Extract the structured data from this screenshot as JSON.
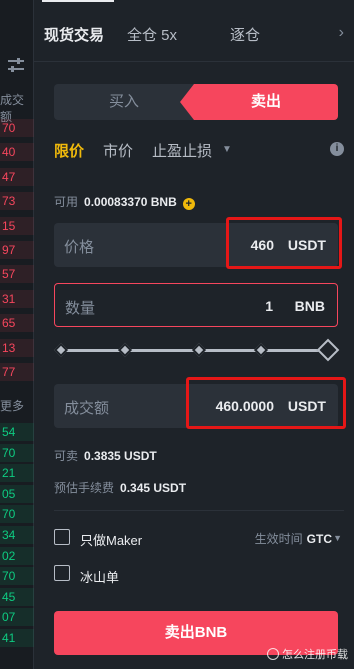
{
  "tabs": [
    {
      "label": "现货交易",
      "active": true
    },
    {
      "label": "全仓 5x",
      "active": false
    },
    {
      "label": "逐仓",
      "active": false
    }
  ],
  "tab_more_icon": "chevron-right-icon",
  "order_book": {
    "header_top": "成交额",
    "header_mid": "更多",
    "asks": [
      "70",
      "40",
      "47",
      "73",
      "15",
      "97",
      "57",
      "31",
      "65",
      "13",
      "77"
    ],
    "bids": [
      "54",
      "70",
      "21",
      "05",
      "70",
      "34",
      "02",
      "70",
      "45",
      "07",
      "41"
    ]
  },
  "side_toggle": {
    "buy": "买入",
    "sell": "卖出",
    "selected": "sell"
  },
  "order_types": {
    "limit": "限价",
    "market": "市价",
    "tpsl": "止盈止损",
    "selected": "limit"
  },
  "info_icon": "i",
  "available": {
    "label": "可用",
    "value": "0.00083370 BNB",
    "add_icon": "+"
  },
  "price_field": {
    "label": "价格",
    "value": "460",
    "unit": "USDT"
  },
  "qty_field": {
    "label": "数量",
    "value": "1",
    "unit": "BNB"
  },
  "slider": {
    "percent": 0
  },
  "total_field": {
    "label": "成交额",
    "value": "460.0000",
    "unit": "USDT"
  },
  "sellable": {
    "label": "可卖",
    "value": "0.3835 USDT"
  },
  "fee": {
    "label": "预估手续费",
    "value": "0.345 USDT"
  },
  "maker_only": {
    "label": "只做Maker",
    "checked": false
  },
  "iceberg": {
    "label": "冰山单",
    "checked": false
  },
  "time_in_force": {
    "label": "生效时间",
    "value": "GTC"
  },
  "submit_label": "卖出BNB",
  "watermark": "怎么注册币载",
  "colors": {
    "sell": "#f6465d",
    "buy": "#0ecb81",
    "accent": "#f0b90b",
    "highlight": "#e51717",
    "bg": "#1e2329",
    "input_bg": "#2b3139"
  }
}
